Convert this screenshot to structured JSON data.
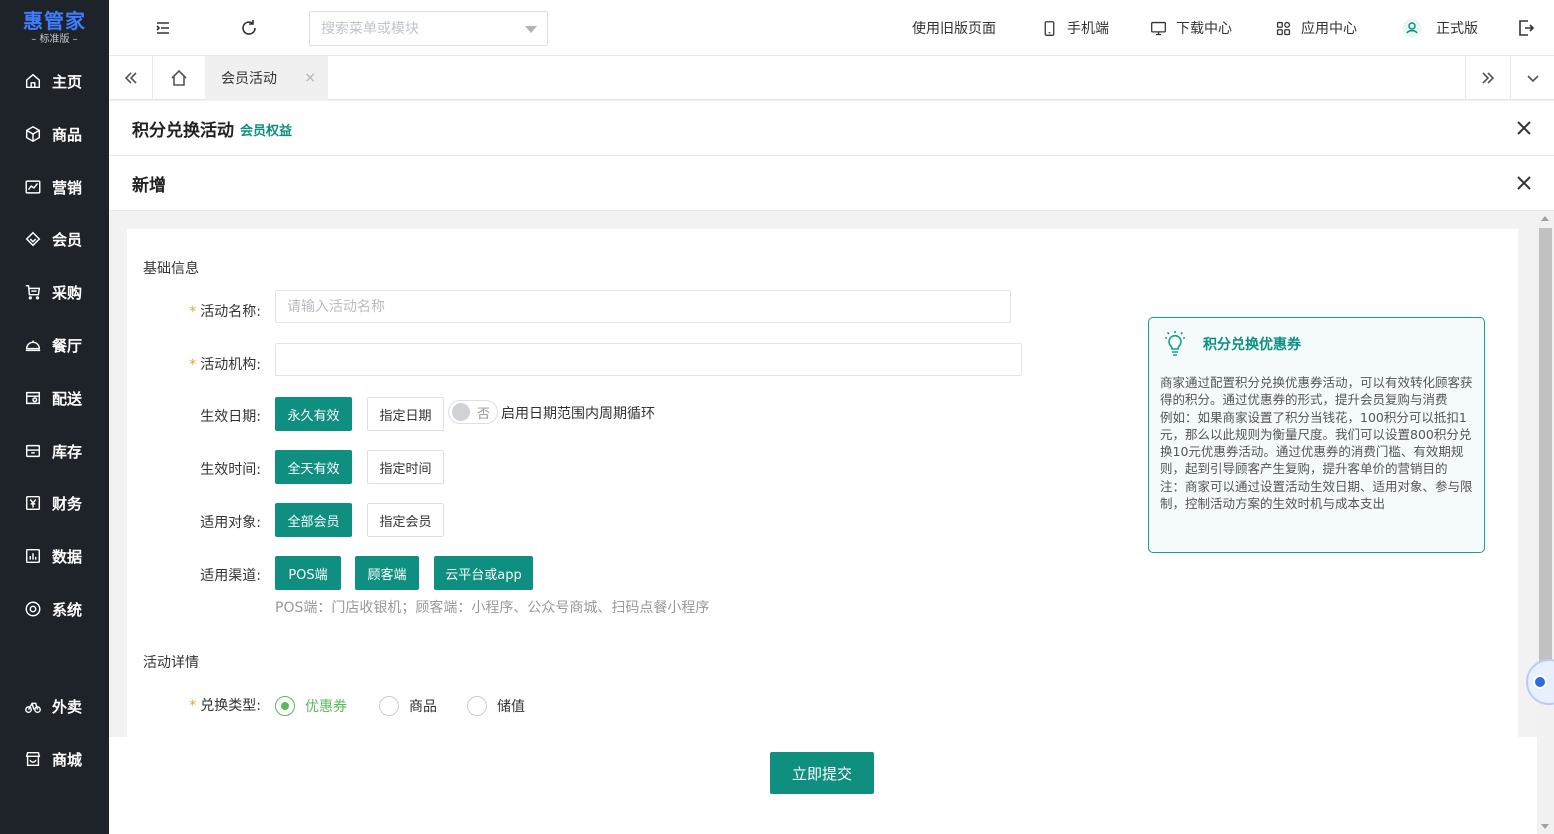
{
  "logo": {
    "main": "惠管家",
    "sub": "– 标准版 –"
  },
  "sidebar": {
    "items": [
      {
        "label": "主页",
        "icon": "home-icon"
      },
      {
        "label": "商品",
        "icon": "box-icon"
      },
      {
        "label": "营销",
        "icon": "chart-icon"
      },
      {
        "label": "会员",
        "icon": "diamond-icon"
      },
      {
        "label": "采购",
        "icon": "cart-icon"
      },
      {
        "label": "餐厅",
        "icon": "cloche-icon"
      },
      {
        "label": "配送",
        "icon": "store-icon"
      },
      {
        "label": "库存",
        "icon": "inventory-icon"
      },
      {
        "label": "财务",
        "icon": "yen-icon"
      },
      {
        "label": "数据",
        "icon": "bar-chart-icon"
      },
      {
        "label": "系统",
        "icon": "settings-icon"
      },
      {
        "label": "外卖",
        "icon": "bike-icon"
      },
      {
        "label": "商城",
        "icon": "shop-icon"
      }
    ]
  },
  "topbar": {
    "search_placeholder": "搜索菜单或模块",
    "links": {
      "old_version": "使用旧版页面",
      "mobile": "手机端",
      "download": "下载中心",
      "apps": "应用中心",
      "edition": "正式版"
    }
  },
  "tabs": {
    "active": "会员活动"
  },
  "header": {
    "title": "积分兑换活动",
    "tag": "会员权益"
  },
  "subheader": {
    "title": "新增"
  },
  "form": {
    "section_basic": "基础信息",
    "name_label": "活动名称:",
    "name_placeholder": "请输入活动名称",
    "name_value": "",
    "org_label": "活动机构:",
    "org_value": "",
    "date_label": "生效日期:",
    "date_opt1": "永久有效",
    "date_opt2": "指定日期",
    "cycle_switch_text": "否",
    "cycle_label": "启用日期范围内周期循环",
    "time_label": "生效时间:",
    "time_opt1": "全天有效",
    "time_opt2": "指定时间",
    "target_label": "适用对象:",
    "target_opt1": "全部会员",
    "target_opt2": "指定会员",
    "channel_label": "适用渠道:",
    "channels": [
      "POS端",
      "顾客端",
      "云平台或app"
    ],
    "channel_hint": "POS端：门店收银机；顾客端：小程序、公众号商城、扫码点餐小程序",
    "section_detail": "活动详情",
    "exchange_label": "兑换类型:",
    "exchange_options": [
      "优惠券",
      "商品",
      "储值"
    ],
    "exchange_selected": "优惠券"
  },
  "info": {
    "title": "积分兑换优惠券",
    "body": "商家通过配置积分兑换优惠券活动，可以有效转化顾客获得的积分。通过优惠券的形式，提升会员复购与消费\n例如：如果商家设置了积分当钱花，100积分可以抵扣1元，那么以此规则为衡量尺度。我们可以设置800积分兑换10元优惠券活动。通过优惠券的消费门槛、有效期规则，起到引导顾客产生复购，提升客单价的营销目的\n注：商家可以通过设置活动生效日期、适用对象、参与限制，控制活动方案的生效时机与成本支出"
  },
  "footer": {
    "submit": "立即提交"
  },
  "colors": {
    "primary": "#0e8f80",
    "sidebar_bg": "#1e2329",
    "logo": "#3f7cff",
    "radio_checked": "#5cb85c",
    "required": "#e6a23c"
  }
}
